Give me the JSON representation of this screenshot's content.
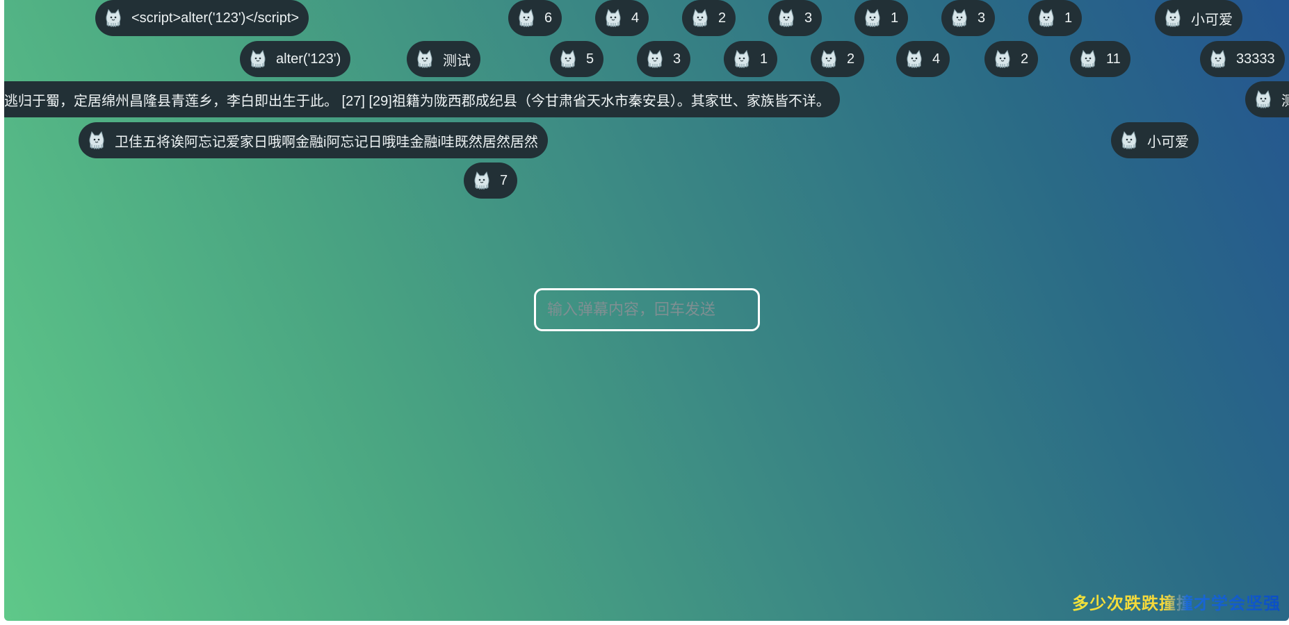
{
  "input": {
    "placeholder": "输入弹幕内容，回车发送"
  },
  "slogan": "多少次跌跌撞撞才学会坚强",
  "avatar_icon": "cat-avatar-icon",
  "danmaku": [
    {
      "text": "<script>alter('123')</script>"
    },
    {
      "text": "6"
    },
    {
      "text": "4"
    },
    {
      "text": "2"
    },
    {
      "text": "3"
    },
    {
      "text": "1"
    },
    {
      "text": "3"
    },
    {
      "text": "1"
    },
    {
      "text": "小可爱"
    },
    {
      "text": "alter('123')"
    },
    {
      "text": "测试"
    },
    {
      "text": "5"
    },
    {
      "text": "3"
    },
    {
      "text": "1"
    },
    {
      "text": "2"
    },
    {
      "text": "4"
    },
    {
      "text": "2"
    },
    {
      "text": "11"
    },
    {
      "text": "33333"
    },
    {
      "text": "逃归于蜀，定居绵州昌隆县青莲乡，李白即出生于此。 [27] [29]祖籍为陇西郡成纪县（今甘肃省天水市秦安县）。其家世、家族皆不详。"
    },
    {
      "text": "测"
    },
    {
      "text": "卫佳五将诶阿忘记爱家日哦啊金融i阿忘记日哦哇金融i哇既然居然居然"
    },
    {
      "text": "小可爱"
    },
    {
      "text": "7"
    }
  ]
}
